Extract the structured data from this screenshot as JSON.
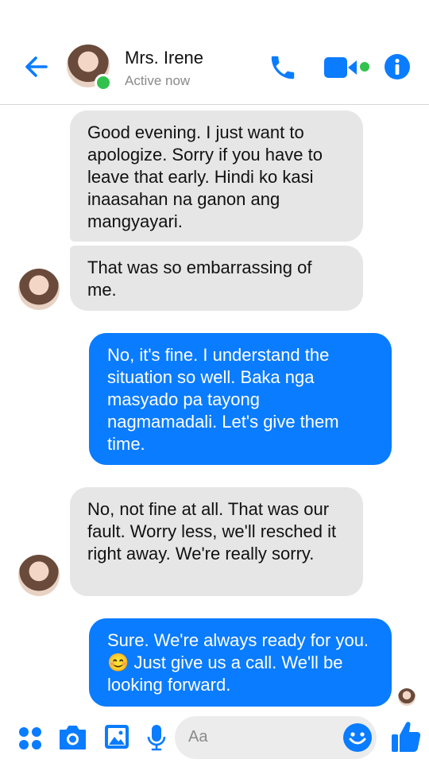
{
  "header": {
    "contact_name": "Mrs. Irene",
    "status": "Active now",
    "icons": [
      "back-arrow-icon",
      "phone-icon",
      "video-camera-icon",
      "info-icon"
    ],
    "accent_color": "#0a7cff",
    "online_color": "#31c24d"
  },
  "messages": [
    {
      "direction": "incoming",
      "text": "Good evening. I just want to apologize. Sorry if you have to leave that early. Hindi ko kasi inaasahan na ganon ang mangyayari."
    },
    {
      "direction": "incoming",
      "text": "That was so embarrassing of me."
    },
    {
      "direction": "outgoing",
      "text": "No, it's fine. I understand the situation so well. Baka nga masyado pa tayong nagmamadali. Let's give them time."
    },
    {
      "direction": "incoming",
      "text": "No, not fine at all. That was our fault. Worry less, we'll resched it right away. We're really sorry."
    },
    {
      "direction": "outgoing",
      "text": "Sure. We're always ready for you. 😊 Just give us a call. We'll be looking forward."
    }
  ],
  "composer": {
    "placeholder": "Aa",
    "icons": [
      "more-apps-icon",
      "camera-icon",
      "gallery-icon",
      "microphone-icon",
      "emoji-icon",
      "thumbs-up-icon"
    ]
  }
}
